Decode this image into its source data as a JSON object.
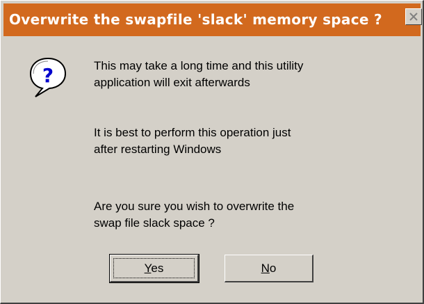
{
  "dialog": {
    "title": "Overwrite the swapfile 'slack' memory space ?",
    "icon": "question-icon",
    "messages": [
      [
        "This may take a long time and this utility",
        "application will exit afterwards"
      ],
      [
        "It is best to perform this operation just",
        "after restarting Windows"
      ],
      [
        "Are you sure you wish to overwrite the",
        "swap file slack space ?"
      ]
    ],
    "buttons": {
      "yes": {
        "mnemonic": "Y",
        "rest": "es"
      },
      "no": {
        "mnemonic": "N",
        "rest": "o"
      }
    }
  },
  "colors": {
    "titlebar": "#d2691e",
    "face": "#d4d0c8"
  }
}
